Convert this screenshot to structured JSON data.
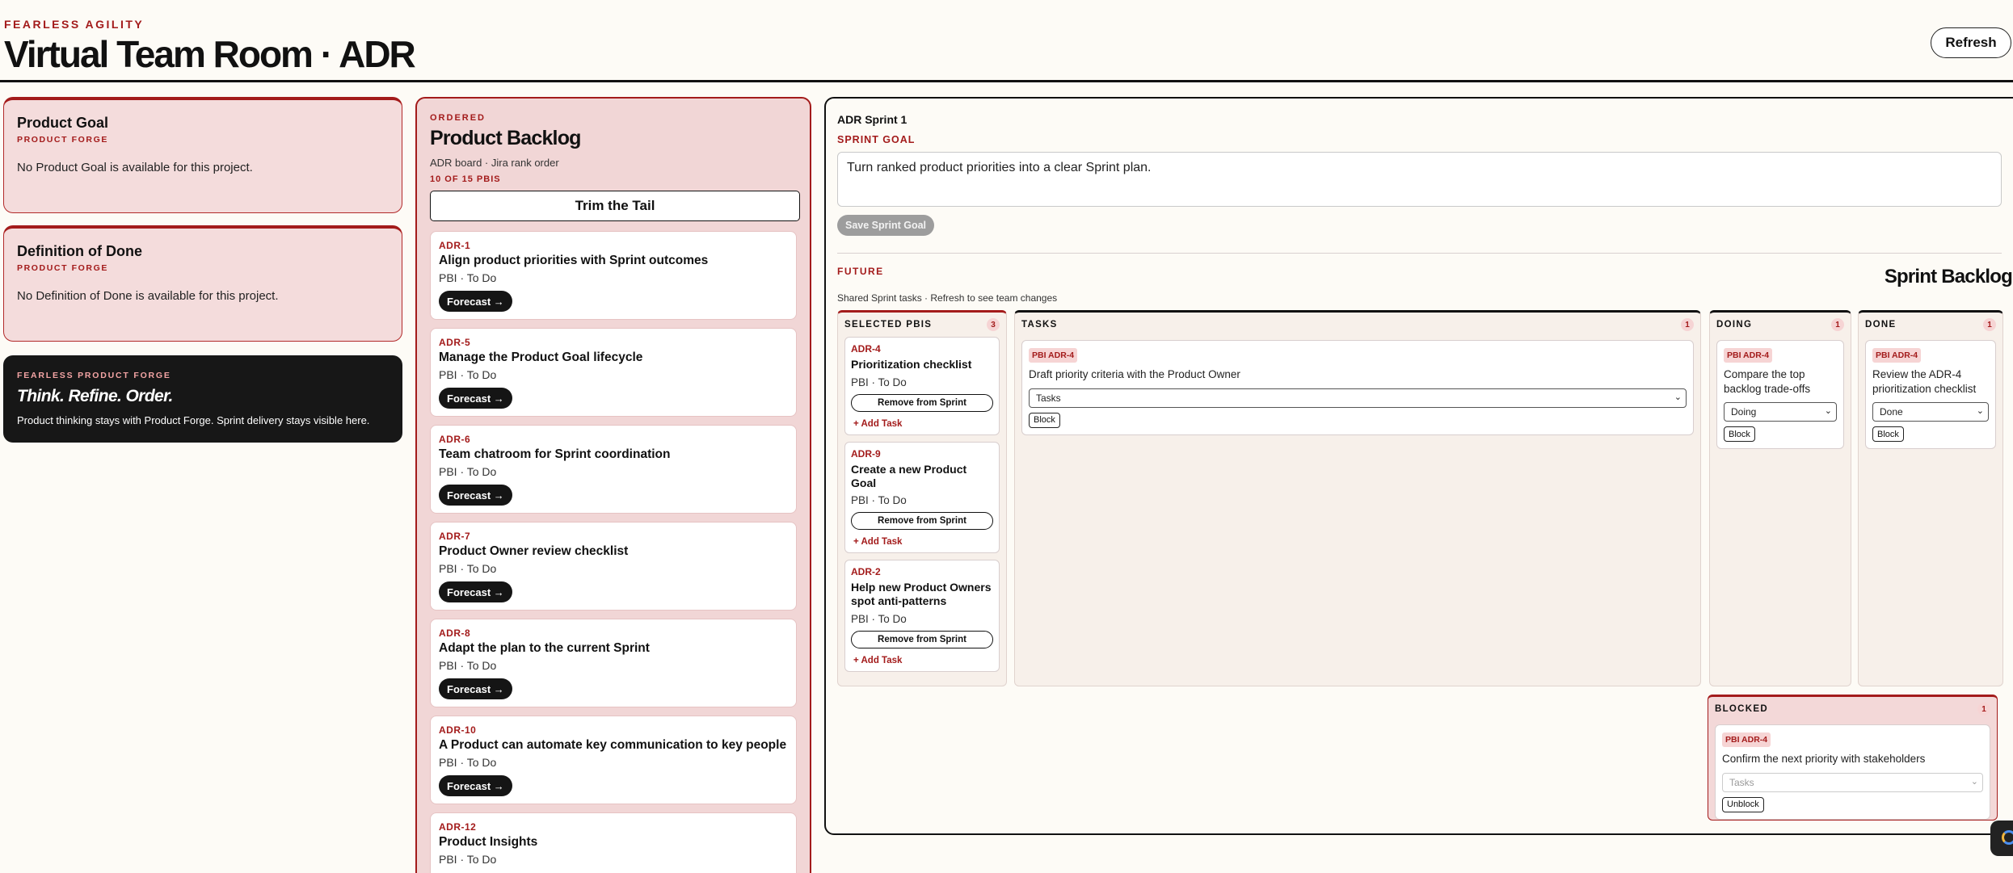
{
  "header": {
    "brand": "FEARLESS AGILITY",
    "title": "Virtual Team Room · ADR",
    "refresh_label": "Refresh"
  },
  "left": {
    "product_goal": {
      "title": "Product Goal",
      "source": "PRODUCT FORGE",
      "message": "No Product Goal is available for this project."
    },
    "definition_of_done": {
      "title": "Definition of Done",
      "source": "PRODUCT FORGE",
      "message": "No Definition of Done is available for this project."
    },
    "promo": {
      "eyebrow": "FEARLESS PRODUCT FORGE",
      "title": "Think. Refine. Order.",
      "text": "Product thinking stays with Product Forge. Sprint delivery stays visible here."
    }
  },
  "backlog": {
    "eyebrow": "ORDERED",
    "title": "Product Backlog",
    "meta": "ADR board · Jira rank order",
    "count": "10 OF 15 PBIS",
    "trim_label": "Trim the Tail",
    "forecast_label": "Forecast →",
    "items": [
      {
        "key": "ADR-1",
        "title": "Align product priorities with Sprint outcomes",
        "status": "PBI · To Do"
      },
      {
        "key": "ADR-5",
        "title": "Manage the Product Goal lifecycle",
        "status": "PBI · To Do"
      },
      {
        "key": "ADR-6",
        "title": "Team chatroom for Sprint coordination",
        "status": "PBI · To Do"
      },
      {
        "key": "ADR-7",
        "title": "Product Owner review checklist",
        "status": "PBI · To Do"
      },
      {
        "key": "ADR-8",
        "title": "Adapt the plan to the current Sprint",
        "status": "PBI · To Do"
      },
      {
        "key": "ADR-10",
        "title": "A Product can automate key communication to key people",
        "status": "PBI · To Do"
      },
      {
        "key": "ADR-12",
        "title": "Product Insights",
        "status": "PBI · To Do"
      }
    ]
  },
  "sprint": {
    "name": "ADR Sprint 1",
    "goal_label": "SPRINT GOAL",
    "goal_value": "Turn ranked product priorities into a clear Sprint plan.",
    "save_label": "Save Sprint Goal",
    "state": "FUTURE",
    "title": "Sprint Backlog",
    "shared_note": "Shared Sprint tasks · Refresh to see team changes",
    "remove_label": "Remove from Sprint",
    "add_task_label": "+ Add Task",
    "block_label": "Block",
    "unblock_label": "Unblock",
    "selected": {
      "label": "SELECTED PBIS",
      "count": "3",
      "items": [
        {
          "key": "ADR-4",
          "title": "Prioritization checklist",
          "status": "PBI · To Do"
        },
        {
          "key": "ADR-9",
          "title": "Create a new Product Goal",
          "status": "PBI · To Do"
        },
        {
          "key": "ADR-2",
          "title": "Help new Product Owners spot anti-patterns",
          "status": "PBI · To Do"
        }
      ]
    },
    "tasks": {
      "label": "TASKS",
      "count": "1",
      "card": {
        "tag": "PBI ADR-4",
        "title": "Draft priority criteria with the Product Owner",
        "select": "Tasks"
      }
    },
    "doing": {
      "label": "DOING",
      "count": "1",
      "card": {
        "tag": "PBI ADR-4",
        "title": "Compare the top backlog trade-offs",
        "select": "Doing"
      }
    },
    "done": {
      "label": "DONE",
      "count": "1",
      "card": {
        "tag": "PBI ADR-4",
        "title": "Review the ADR-4 prioritization checklist",
        "select": "Done"
      }
    },
    "blocked": {
      "label": "BLOCKED",
      "count": "1",
      "card": {
        "tag": "PBI ADR-4",
        "title": "Confirm the next priority with stakeholders",
        "select": "Tasks"
      }
    }
  },
  "colors": {
    "accent": "#a31b1b",
    "panel_pink": "#f4dcdc",
    "dark": "#171717",
    "background": "#fdfbf6"
  }
}
